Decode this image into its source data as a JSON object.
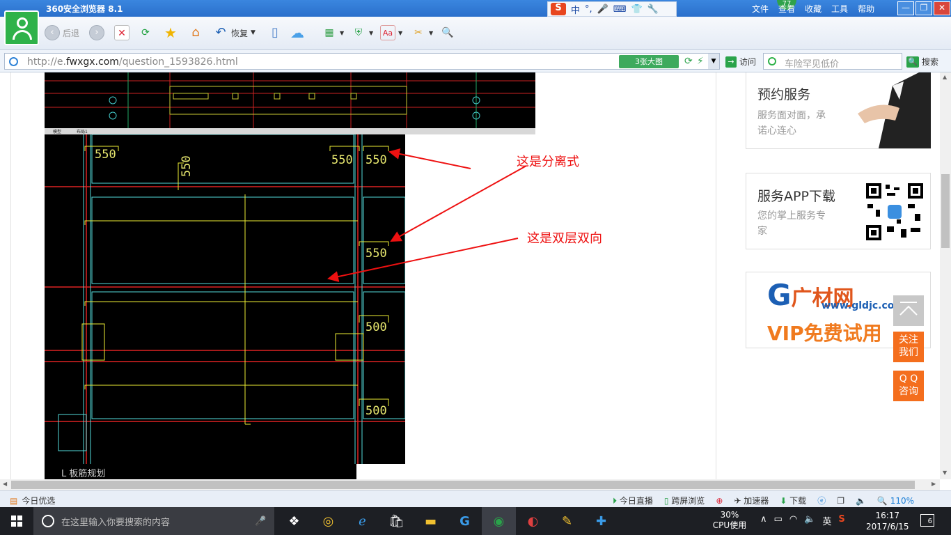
{
  "browser": {
    "title": "360安全浏览器 8.1",
    "menu": [
      "文件",
      "查看",
      "收藏",
      "工具",
      "帮助"
    ],
    "badge": "77",
    "ime": {
      "logo": "S",
      "mode": "中"
    }
  },
  "toolbar": {
    "back": "后退",
    "restore": "恢复"
  },
  "address": {
    "url_prefix": "http://e.",
    "url_domain": "fwxgx.com",
    "url_suffix": "/question_1593826.html",
    "bigpic_label": "3张大图",
    "visit_label": "访问",
    "search_placeholder": "车险罕见低价",
    "search_label": "搜索"
  },
  "content": {
    "annotation1": "这是分离式",
    "annotation2": "这是双层双向",
    "cad_bottom_text": "L 板筋规划",
    "cad_tabs": [
      "模型",
      "布局1"
    ],
    "dims": [
      "550",
      "550",
      "550",
      "550",
      "550",
      "500",
      "500"
    ]
  },
  "sidebar": {
    "card1": {
      "title": "预约服务",
      "text1": "服务面对面，承",
      "text2": "诺心连心"
    },
    "card2": {
      "title": "服务APP下载",
      "text1": "您的掌上服务专",
      "text2": "家"
    },
    "card3": {
      "brand": "广材网",
      "url": "www.gldjc.com",
      "vip": "VIP免费试用"
    },
    "follow": [
      "关注",
      "我们"
    ],
    "qq": [
      "Q Q",
      "咨询"
    ]
  },
  "statusbar": {
    "today_pick": "今日优选",
    "live": "今日直播",
    "cross": "跨屏浏览",
    "accel": "加速器",
    "download": "下载",
    "zoom": "110%"
  },
  "taskbar": {
    "search_placeholder": "在这里输入你要搜索的内容",
    "cpu_percent": "30%",
    "cpu_label": "CPU使用",
    "lang": "英",
    "time": "16:17",
    "date": "2017/6/15",
    "notifications": "6"
  }
}
